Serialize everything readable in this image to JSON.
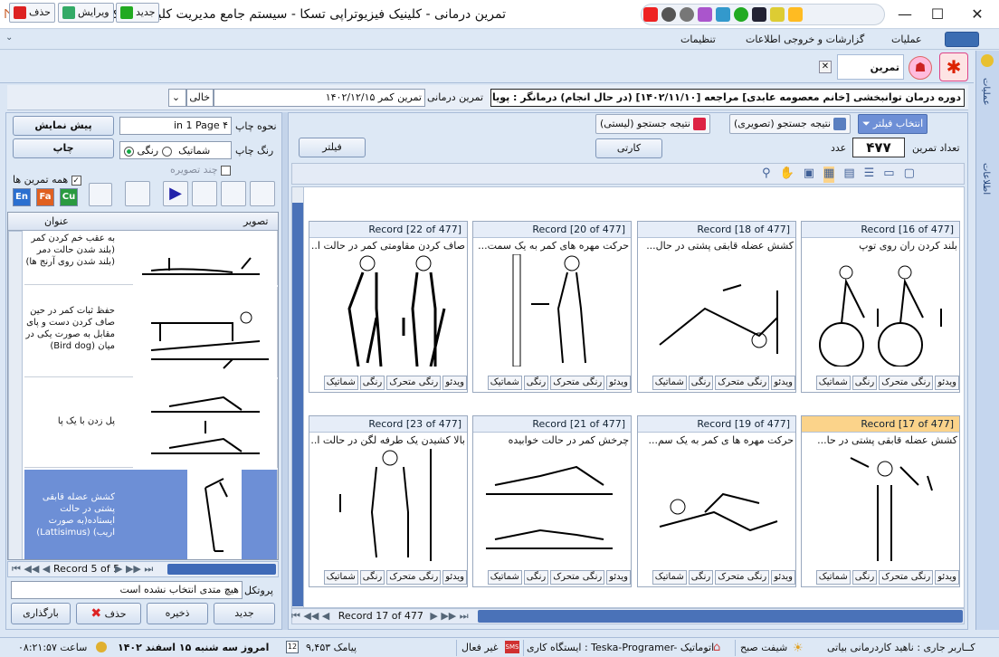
{
  "window": {
    "title": "تمرین درمانی - کلینیک فیزیوتراپی تسکا - سیستم جامع مدیریت کلینیک تسکا"
  },
  "menu": {
    "items": [
      "عملیات",
      "گزارشات و خروجی اطلاعات",
      "تنظیمات"
    ]
  },
  "right_tabs": [
    "عملیات",
    "اطلاعات"
  ],
  "doc_tab": {
    "label": "تمرین درمانی"
  },
  "toolbar": {
    "delete": "حذف",
    "edit": "ویرایش",
    "new": "جدید",
    "combo_value": "خالی",
    "session_label": "تمرین درمانی",
    "session_value": "تمرین کمر ۱۴۰۲/۱۲/۱۵",
    "info": "دوره درمان  توانبخشی [خانم معصومه عابدی] مراجعه [۱۴۰۲/۱۱/۱۰] (در حال انجام)  درمانگر : پویا م"
  },
  "left": {
    "preview": "پیش نمایش",
    "print": "چاپ",
    "print_mode_label": "نحوه چاپ",
    "print_mode_value": "in 1 Page ۴",
    "color_label": "رنگ چاپ",
    "color_opt": "رنگی",
    "schematic_opt": "شماتیک",
    "multi_image": "چند تصویره",
    "all_exercises": "همه تمرین ها",
    "langs": [
      "En",
      "Fa",
      "Cu"
    ],
    "grid_headers": {
      "image": "تصویر",
      "title": "عنوان"
    },
    "rows": [
      {
        "title": "به عقب خم کردن کمر (بلند شدن حالت دمر (بلند شدن روی آرنج ها)"
      },
      {
        "title": "حفظ ثبات کمر در حین صاف کردن دست و پای مقابل به صورت یکی در میان (Bird dog)"
      },
      {
        "title": "پل زدن با یک پا"
      },
      {
        "title": "کشش عضله قابقی پشتی در حالت ایستاده(به صورت اریب) (Lattisimus)"
      }
    ],
    "nav": "Record 5 of 5",
    "protocol_label": "پروتکل",
    "protocol_value": "هیچ متدی انتخاب نشده است",
    "b_new": "جدید",
    "b_save": "ذخیره",
    "b_del": "حذف",
    "b_load": "بارگذاری"
  },
  "right": {
    "tabs": [
      "انتخاب فیلتر",
      "(نتیجه جستجو (تصویری",
      "(نتیجه جستجو (لیستی"
    ],
    "count_label": "تعداد تمرین",
    "count_value": "۴۷۷",
    "count_unit": "عدد",
    "cards_btn": "کارتی",
    "filter_btn": "فیلتر",
    "nav": "Record 17 of 477",
    "card_buttons": [
      "ویدئو",
      "رنگی متحرک",
      "رنگی",
      "شماتیک"
    ],
    "cards": [
      {
        "rec": "Record [16 of 477]",
        "title": "بلند کردن ران روی توپ"
      },
      {
        "rec": "Record [18 of 477]",
        "title": "کشش عضله قابقی پشتی در حال..."
      },
      {
        "rec": "Record [20 of 477]",
        "title": "حرکت مهره های کمر به یک سمت..."
      },
      {
        "rec": "Record [22 of 477]",
        "title": "صاف کردن مقاومتی کمر در حالت ا..."
      },
      {
        "rec": "Record [17 of 477]",
        "title": "کشش عضله قابقی پشتی در حا..."
      },
      {
        "rec": "Record [19 of 477]",
        "title": "حرکت مهره ها ی کمر به یک سم..."
      },
      {
        "rec": "Record [21 of 477]",
        "title": "چرخش کمر در حالت خوابیده"
      },
      {
        "rec": "Record [23 of 477]",
        "title": "بالا کشیدن یک طرفه لگن در حالت ا..."
      }
    ]
  },
  "status": {
    "user": "کــاربر جاری : ناهید کاردرمانی بیاتی",
    "shift": "شیفت صبح",
    "station": "ایستگاه کاری : Teska-Programer- اتوماتیک",
    "sms_state": "غیر فعال",
    "sms_count": "۹,۴۵۳ پیامک",
    "date": "امروز سه شنبه ۱۵ اسفند ۱۴۰۲",
    "clock": "ساعت ۰۸:۲۱:۵۷",
    "cal_day": "12"
  }
}
